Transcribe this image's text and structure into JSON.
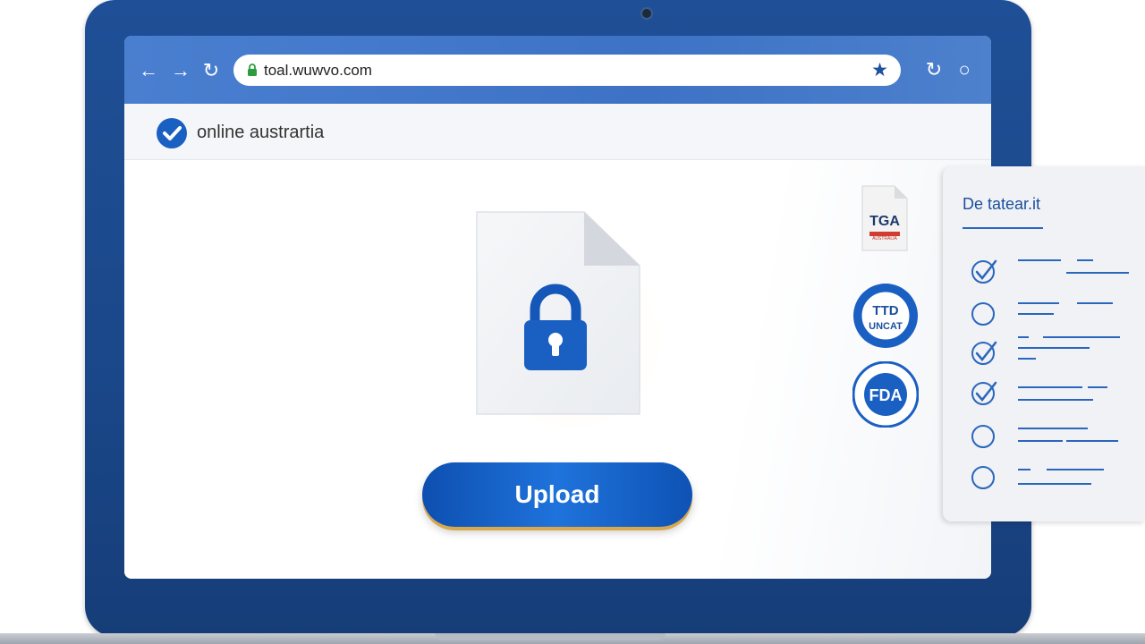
{
  "browser": {
    "url": "toal.wuwvo.com",
    "back_icon": "←",
    "forward_icon": "→",
    "reload_icon": "↻",
    "bookmark_icon": "★",
    "extension_icon": "↻",
    "profile_icon": "○"
  },
  "site": {
    "brand_name": "online austrartia"
  },
  "main": {
    "upload_label": "Upload"
  },
  "badges": {
    "tga": "TGA",
    "tga_sub": "AUSTRALIA",
    "seal1_text": "TTD",
    "seal1_sub": "UNCAT",
    "seal2_text": "FDA"
  },
  "checklist": {
    "title": "De tatear.it",
    "items": [
      {
        "checked": true
      },
      {
        "checked": false
      },
      {
        "checked": true
      },
      {
        "checked": true
      },
      {
        "checked": false
      },
      {
        "checked": false
      }
    ]
  },
  "colors": {
    "frame": "#1f4f96",
    "toolbar": "#4a7fd0",
    "accent": "#1f73dc",
    "upload_shadow": "#d9a84a"
  }
}
